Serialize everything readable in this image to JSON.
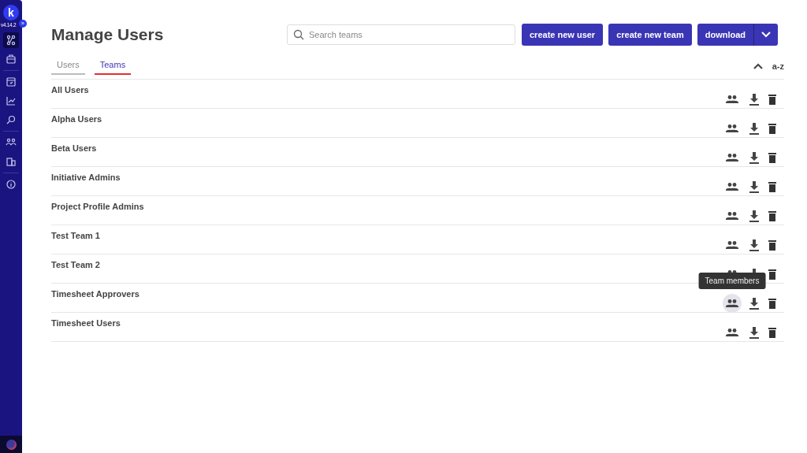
{
  "sidebar": {
    "logo": "k",
    "version": "v4.14.2",
    "expand": "»"
  },
  "page": {
    "title": "Manage Users"
  },
  "search": {
    "placeholder": "Search teams"
  },
  "buttons": [
    "create new user",
    "create new team",
    "download"
  ],
  "tabs": [
    {
      "label": "Users",
      "selected": false
    },
    {
      "label": "Teams",
      "selected": true
    }
  ],
  "sort": {
    "label": "a-z"
  },
  "tooltip": "Team members",
  "teams": [
    {
      "name": "All Users",
      "hovered": false
    },
    {
      "name": "Alpha Users",
      "hovered": false
    },
    {
      "name": "Beta Users",
      "hovered": false
    },
    {
      "name": "Initiative Admins",
      "hovered": false
    },
    {
      "name": "Project Profile Admins",
      "hovered": false
    },
    {
      "name": "Test Team 1",
      "hovered": false
    },
    {
      "name": "Test Team 2",
      "hovered": false
    },
    {
      "name": "Timesheet Approvers",
      "hovered": true
    },
    {
      "name": "Timesheet Users",
      "hovered": false
    }
  ]
}
